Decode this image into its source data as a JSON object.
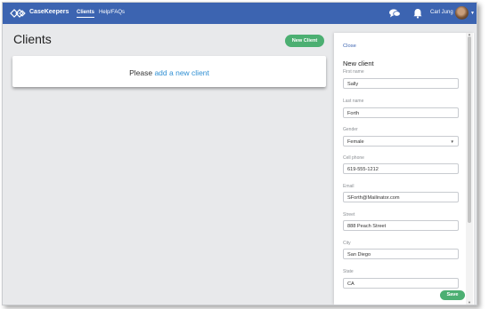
{
  "topnav": {
    "brand": "CaseKeepers",
    "links": [
      "Clients",
      "Help/FAQs"
    ],
    "user_name": "Carl Jung",
    "icons": [
      "chat-icon",
      "bell-icon"
    ],
    "bg_color": "#3c64b1"
  },
  "main": {
    "title": "Clients",
    "new_client_button": "New Client",
    "empty_prefix": "Please ",
    "empty_link": "add a new client"
  },
  "panel": {
    "close": "Close",
    "title": "New client",
    "fields": [
      {
        "label": "First name",
        "value": "Sally"
      },
      {
        "label": "Last name",
        "value": "Forth"
      },
      {
        "label": "Gender",
        "value": "Female"
      },
      {
        "label": "Cell phone",
        "value": "619-555-1212"
      },
      {
        "label": "Email",
        "value": "SForth@Mailinator.com"
      },
      {
        "label": "Street",
        "value": "888 Peach Street"
      },
      {
        "label": "City",
        "value": "San Diego"
      },
      {
        "label": "State",
        "value": "CA"
      }
    ],
    "save": "Save"
  },
  "colors": {
    "accent_green": "#4caf72",
    "link_blue": "#2f8fd3"
  }
}
